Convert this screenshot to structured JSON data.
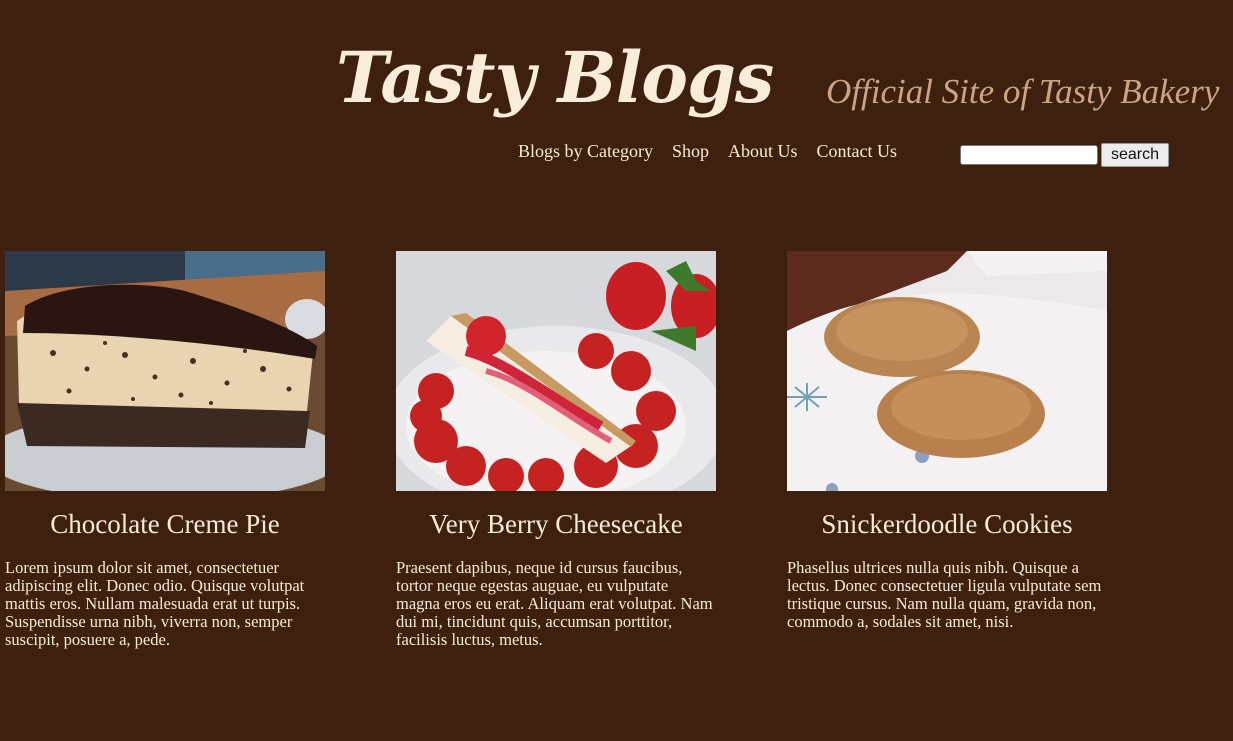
{
  "header": {
    "title": "Tasty Blogs",
    "tagline": "Official Site of Tasty Bakery"
  },
  "nav": {
    "items": [
      {
        "label": "Blogs by Category"
      },
      {
        "label": "Shop"
      },
      {
        "label": "About Us"
      },
      {
        "label": "Contact Us"
      }
    ]
  },
  "search": {
    "value": "",
    "button_label": "search"
  },
  "posts": [
    {
      "title": "Chocolate Creme Pie",
      "text": "Lorem ipsum dolor sit amet, consectetuer adipiscing elit. Donec odio. Quisque volutpat mattis eros. Nullam malesuada erat ut turpis. Suspendisse urna nibh, viverra non, semper suscipit, posuere a, pede.",
      "image": "chocolate-creme-pie-photo"
    },
    {
      "title": "Very Berry Cheesecake",
      "text": "Praesent dapibus, neque id cursus faucibus, tortor neque egestas auguae, eu vulputate magna eros eu erat. Aliquam erat volutpat. Nam dui mi, tincidunt quis, accumsan porttitor, facilisis luctus, metus.",
      "image": "berry-cheesecake-photo"
    },
    {
      "title": "Snickerdoodle Cookies",
      "text": "Phasellus ultrices nulla quis nibh. Quisque a lectus. Donec consectetuer ligula vulputate sem tristique cursus. Nam nulla quam, gravida non, commodo a, sodales sit amet, nisi.",
      "image": "snickerdoodle-cookies-photo"
    }
  ],
  "colors": {
    "background": "#3e200e",
    "text": "#f7ead9",
    "tagline": "#c9a486"
  }
}
